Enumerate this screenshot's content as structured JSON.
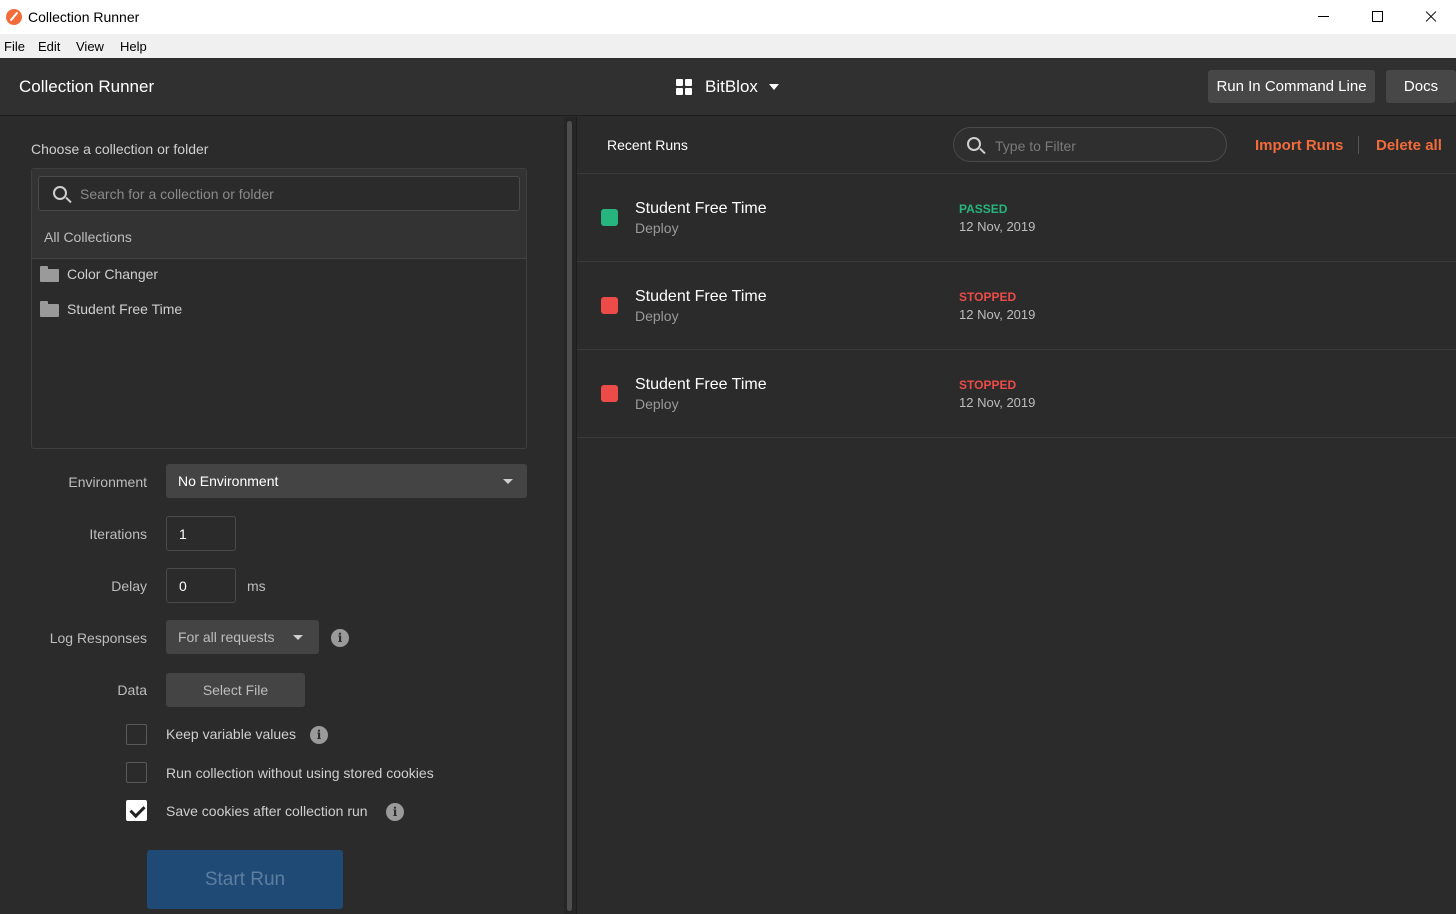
{
  "window": {
    "title": "Collection Runner"
  },
  "menu": [
    "File",
    "Edit",
    "View",
    "Help"
  ],
  "header": {
    "title": "Collection Runner",
    "workspace": "BitBlox",
    "run_cli_label": "Run In Command Line",
    "docs_label": "Docs"
  },
  "left": {
    "choose_label": "Choose a collection or folder",
    "search_placeholder": "Search for a collection or folder",
    "all_collections": "All Collections",
    "collections": [
      {
        "name": "Color Changer"
      },
      {
        "name": "Student Free Time"
      }
    ],
    "environment": {
      "label": "Environment",
      "value": "No Environment"
    },
    "iterations": {
      "label": "Iterations",
      "value": "1"
    },
    "delay": {
      "label": "Delay",
      "value": "0",
      "unit": "ms"
    },
    "log_responses": {
      "label": "Log Responses",
      "value": "For all requests"
    },
    "data": {
      "label": "Data",
      "button": "Select File"
    },
    "options": [
      {
        "label": "Keep variable values",
        "checked": false
      },
      {
        "label": "Run collection without using stored cookies",
        "checked": false
      },
      {
        "label": "Save cookies after collection run",
        "checked": true
      }
    ],
    "start_label": "Start Run"
  },
  "right": {
    "title": "Recent Runs",
    "filter_placeholder": "Type to Filter",
    "import_label": "Import Runs",
    "delete_label": "Delete all",
    "runs": [
      {
        "name": "Student Free Time",
        "env": "Deploy",
        "status": "PASSED",
        "date": "12 Nov, 2019"
      },
      {
        "name": "Student Free Time",
        "env": "Deploy",
        "status": "STOPPED",
        "date": "12 Nov, 2019"
      },
      {
        "name": "Student Free Time",
        "env": "Deploy",
        "status": "STOPPED",
        "date": "12 Nov, 2019"
      }
    ]
  },
  "colors": {
    "accent": "#f26b3a",
    "passed": "#26b47f",
    "stopped": "#ed4b48",
    "start_button": "#1f4a75"
  }
}
